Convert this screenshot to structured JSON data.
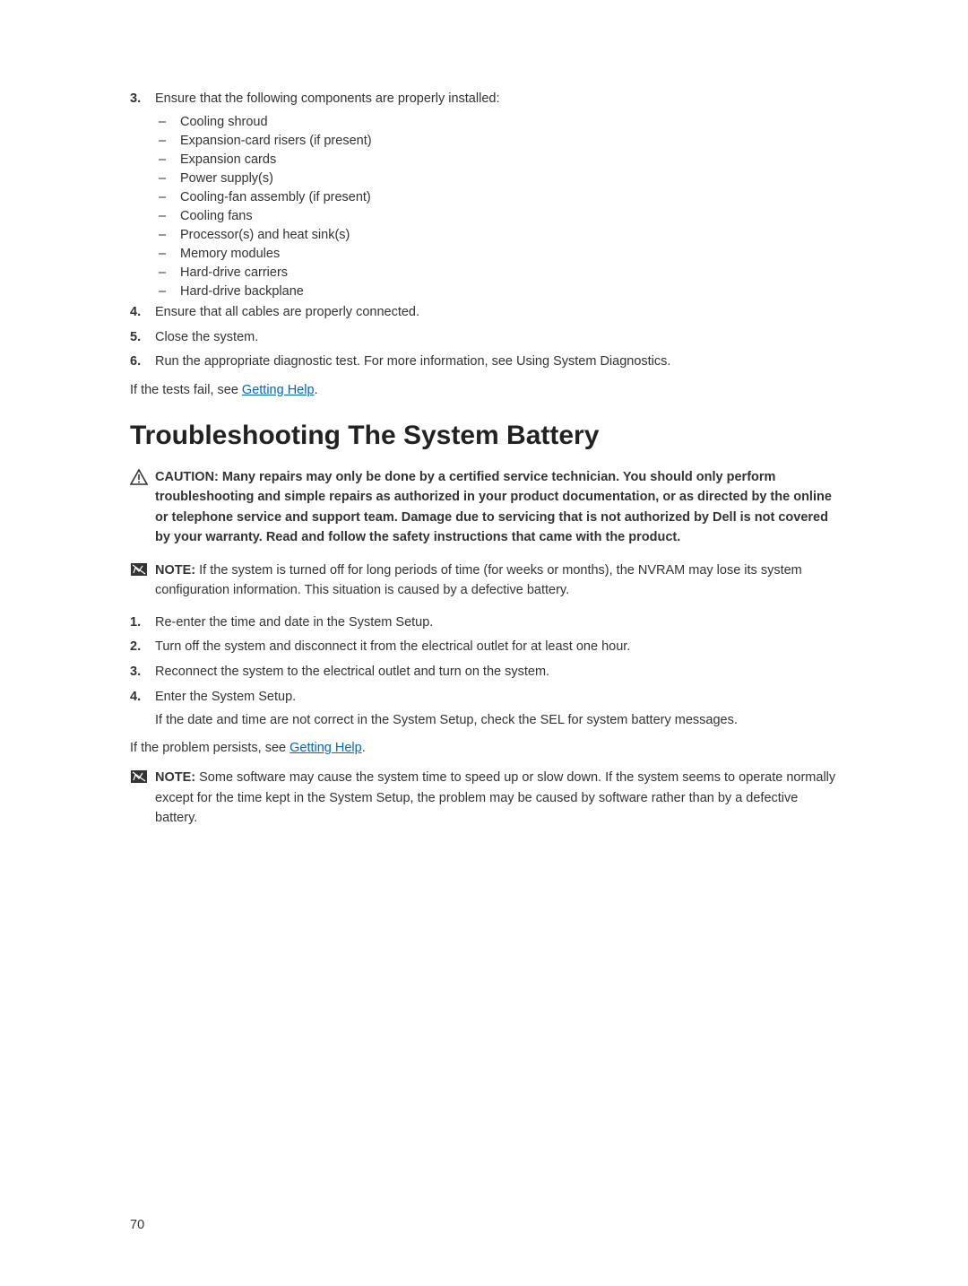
{
  "step3": {
    "num": "3.",
    "lead": "Ensure that the following components are properly installed:",
    "items": [
      "Cooling shroud",
      "Expansion-card risers (if present)",
      "Expansion cards",
      "Power supply(s)",
      "Cooling-fan assembly (if present)",
      "Cooling fans",
      "Processor(s) and heat sink(s)",
      "Memory modules",
      "Hard-drive carriers",
      "Hard-drive backplane"
    ]
  },
  "step4": {
    "num": "4.",
    "text": "Ensure that all cables are properly connected."
  },
  "step5": {
    "num": "5.",
    "text": "Close the system."
  },
  "step6": {
    "num": "6.",
    "text": "Run the appropriate diagnostic test. For more information, see Using System Diagnostics."
  },
  "tests_fail_prefix": "If the tests fail, see ",
  "getting_help": "Getting Help",
  "period": ".",
  "heading": "Troubleshooting The System Battery",
  "caution": {
    "label": "CAUTION: ",
    "text": "Many repairs may only be done by a certified service technician. You should only perform troubleshooting and simple repairs as authorized in your product documentation, or as directed by the online or telephone service and support team. Damage due to servicing that is not authorized by Dell is not covered by your warranty. Read and follow the safety instructions that came with the product."
  },
  "note1": {
    "label": "NOTE: ",
    "text": "If the system is turned off for long periods of time (for weeks or months), the NVRAM may lose its system configuration information. This situation is caused by a defective battery."
  },
  "steps_b": {
    "s1": {
      "num": "1.",
      "text": "Re-enter the time and date in the System Setup."
    },
    "s2": {
      "num": "2.",
      "text": "Turn off the system and disconnect it from the electrical outlet for at least one hour."
    },
    "s3": {
      "num": "3.",
      "text": "Reconnect the system to the electrical outlet and turn on the system."
    },
    "s4": {
      "num": "4.",
      "text": "Enter the System Setup.",
      "sub": "If the date and time are not correct in the System Setup, check the SEL for system battery messages."
    }
  },
  "persists_prefix": "If the problem persists, see ",
  "note2": {
    "label": "NOTE: ",
    "text": "Some software may cause the system time to speed up or slow down. If the system seems to operate normally except for the time kept in the System Setup, the problem may be caused by software rather than by a defective battery."
  },
  "page_number": "70"
}
